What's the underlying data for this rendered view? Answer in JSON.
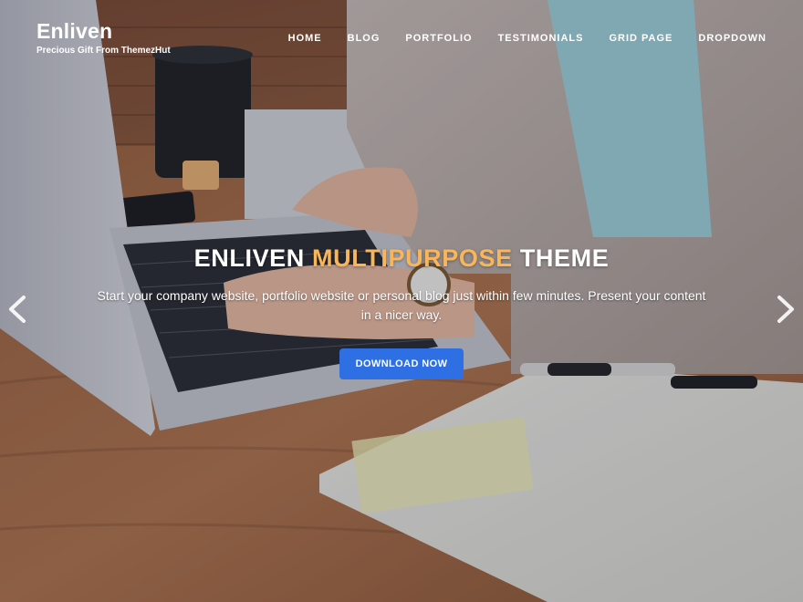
{
  "site": {
    "title": "Enliven",
    "tagline": "Precious Gift From ThemezHut"
  },
  "nav": {
    "items": [
      {
        "label": "HOME"
      },
      {
        "label": "BLOG"
      },
      {
        "label": "PORTFOLIO"
      },
      {
        "label": "TESTIMONIALS"
      },
      {
        "label": "GRID PAGE"
      },
      {
        "label": "DROPDOWN"
      }
    ]
  },
  "slide": {
    "heading_part1": "ENLIVEN ",
    "heading_accent": "MULTIPURPOSE",
    "heading_part2": " THEME",
    "text": "Start your company website, portfolio website or personal blog just within few minutes. Present your content in a nicer way.",
    "button_label": "DOWNLOAD NOW"
  },
  "slider": {
    "prev_icon": "chevron-left-icon",
    "next_icon": "chevron-right-icon"
  },
  "colors": {
    "accent": "#f8b55a",
    "button": "#2f6fe4",
    "text": "#ffffff"
  }
}
